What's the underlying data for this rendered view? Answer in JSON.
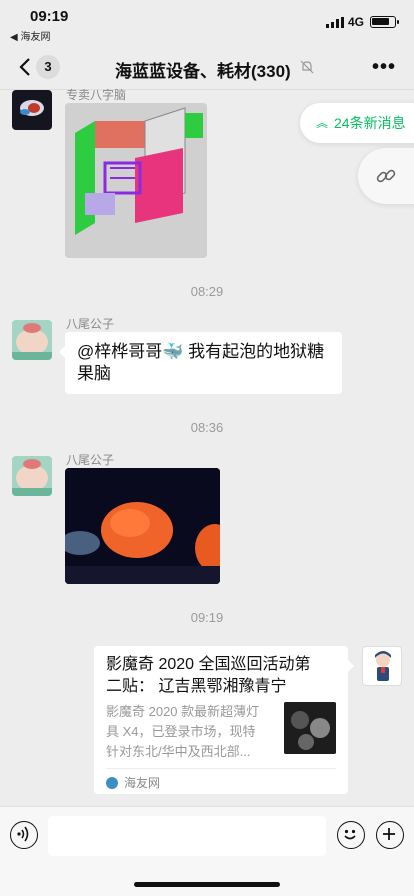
{
  "status": {
    "time": "09:19",
    "back_app": "◀ 海友网",
    "network": "4G"
  },
  "nav": {
    "unread_count": "3",
    "title": "海蓝蓝设备、耗材(330)"
  },
  "floating": {
    "new_messages": "24条新消息"
  },
  "messages": [
    {
      "type": "image",
      "sender": "专卖八字脑"
    },
    {
      "type": "time",
      "text": "08:29"
    },
    {
      "type": "text",
      "sender": "八尾公子",
      "text_line1": "@梓桦哥哥🐳 我有起泡的地狱糖",
      "text_line2": "果脑"
    },
    {
      "type": "time",
      "text": "08:36"
    },
    {
      "type": "image",
      "sender": "八尾公子"
    },
    {
      "type": "time",
      "text": "09:19"
    },
    {
      "type": "link",
      "title_line1": "影魔奇 2020 全国巡回活动第",
      "title_line2": "二贴： 辽吉黑鄂湘豫青宁",
      "desc_line1": "影魔奇 2020 款最新超薄灯",
      "desc_line2": "具 X4，已登录市场，现特",
      "desc_line3": "针对东北/华中及西北部...",
      "source": "海友网"
    }
  ],
  "colors": {
    "accent": "#07c160",
    "background": "#ededed"
  }
}
